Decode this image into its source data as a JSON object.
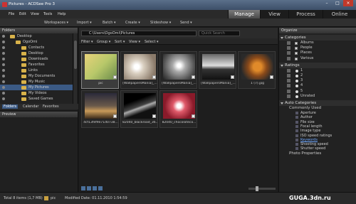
{
  "window": {
    "title": "Pictures - ACDSee Pro 3",
    "minimize": "–",
    "maximize": "□",
    "close": "×"
  },
  "menu": [
    "File",
    "Edit",
    "View",
    "Tools",
    "Help"
  ],
  "modes": [
    "Manage",
    "View",
    "Process",
    "Online"
  ],
  "toolbar": [
    "Workspaces ▾",
    "Import ▾",
    "Batch ▾",
    "Create ▾",
    "Slideshow ▾",
    "Send ▾"
  ],
  "folders": {
    "title": "Folders",
    "items": [
      {
        "label": "Desktop",
        "indent": 0
      },
      {
        "label": "OgoOmi",
        "indent": 1
      },
      {
        "label": "Contacts",
        "indent": 2
      },
      {
        "label": "Desktop",
        "indent": 2
      },
      {
        "label": "Downloads",
        "indent": 2
      },
      {
        "label": "Favorites",
        "indent": 2
      },
      {
        "label": "Links",
        "indent": 2
      },
      {
        "label": "My Documents",
        "indent": 2
      },
      {
        "label": "My Music",
        "indent": 2
      },
      {
        "label": "My Pictures",
        "indent": 2,
        "selected": true
      },
      {
        "label": "My Videos",
        "indent": 2
      },
      {
        "label": "Saved Games",
        "indent": 2
      }
    ],
    "tabs": [
      "Folders",
      "Calendar",
      "Favorites"
    ]
  },
  "preview": {
    "title": "Preview"
  },
  "browser": {
    "path": "C:\\Users\\OgoOmi\\Pictures",
    "search_placeholder": "Quick Search",
    "filters": [
      "Filter ▾",
      "Group ▾",
      "Sort ▾",
      "View ▾",
      "Select ▾"
    ],
    "thumbnails": [
      {
        "caption": "pic",
        "selected": true
      },
      {
        "caption": "[WallpapersMania]_..."
      },
      {
        "caption": "[WallpapersMania]_..."
      },
      {
        "caption": "[WallpapersMania]_..."
      },
      {
        "caption": "1 (7).jpg"
      },
      {
        "caption": "4cf13fef9e71d0738..."
      },
      {
        "caption": "82040_blackroad_36..."
      },
      {
        "caption": "82040_chocolateco..."
      }
    ]
  },
  "status": {
    "total": "Total 8 items  (1,7 MB)",
    "current": "pic",
    "modified": "Modified Date: 01.11.2010 1:54:59"
  },
  "organize": {
    "title": "Organize",
    "categories_title": "Categories",
    "categories": [
      "Albums",
      "People",
      "Places",
      "Various"
    ],
    "ratings_title": "Ratings",
    "ratings": [
      "1",
      "2",
      "3",
      "4",
      "5",
      "Unrated"
    ],
    "auto_title": "Auto Categories",
    "commonly_used": "Commonly Used",
    "auto_items": [
      "Aperture",
      "Author",
      "File size",
      "Focal length",
      "Image type",
      "ISO speed ratings",
      "Keywords",
      "Shooting speed",
      "Shutter speed"
    ],
    "photo_properties": "Photo Properties"
  },
  "watermark": "GUGA.3dn.ru"
}
